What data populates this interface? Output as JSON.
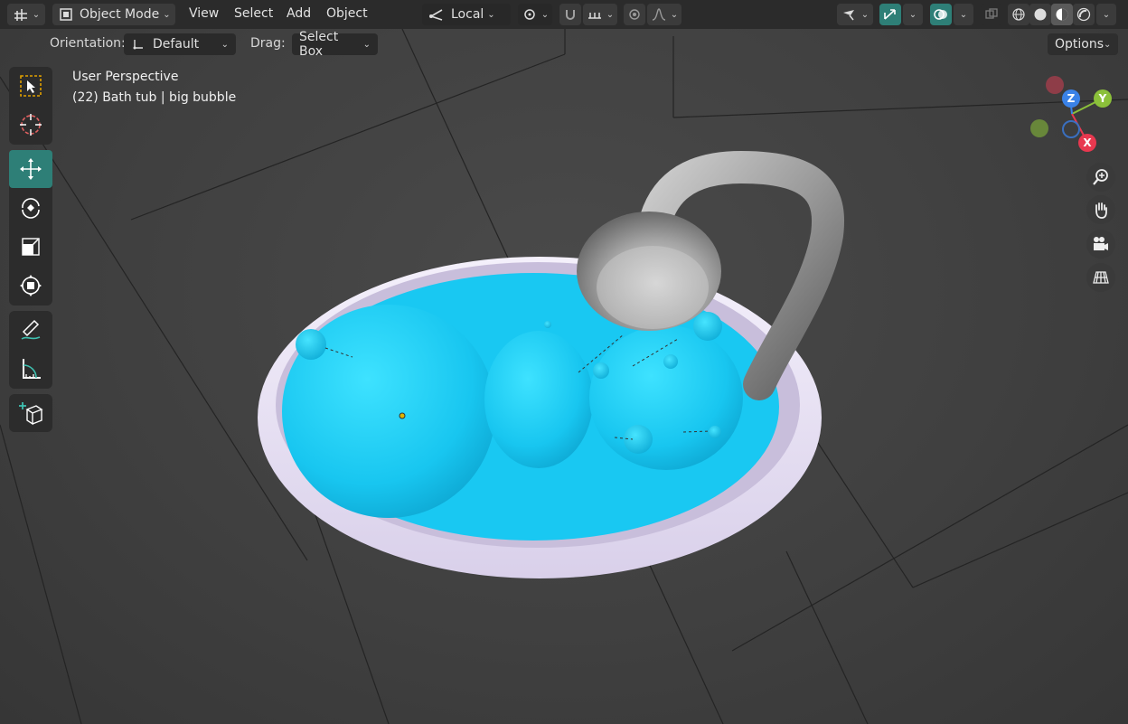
{
  "header": {
    "mode_label": "Object Mode",
    "menus": {
      "view": "View",
      "select": "Select",
      "add": "Add",
      "object": "Object"
    },
    "transform_space": "Local"
  },
  "tool_settings": {
    "orientation_label": "Orientation:",
    "orientation_value": "Default",
    "drag_label": "Drag:",
    "drag_value": "Select Box",
    "options_label": "Options"
  },
  "overlay_info": {
    "view_name": "User Perspective",
    "object_info": "(22) Bath tub | big bubble"
  },
  "gizmo": {
    "x": "X",
    "y": "Y",
    "z": "Z"
  },
  "colors": {
    "accent": "#2e7f77",
    "water": "#1ccfff",
    "axis_x": "#e8384f",
    "axis_y": "#8bc03a",
    "axis_z": "#3a82e8"
  },
  "icons": {
    "toolbar": [
      "select-box-icon",
      "cursor-icon",
      "move-icon",
      "rotate-icon",
      "scale-icon",
      "transform-icon",
      "annotate-icon",
      "measure-icon",
      "add-cube-icon"
    ],
    "nav": [
      "zoom-icon",
      "pan-hand-icon",
      "camera-icon",
      "grid-ortho-icon"
    ]
  }
}
